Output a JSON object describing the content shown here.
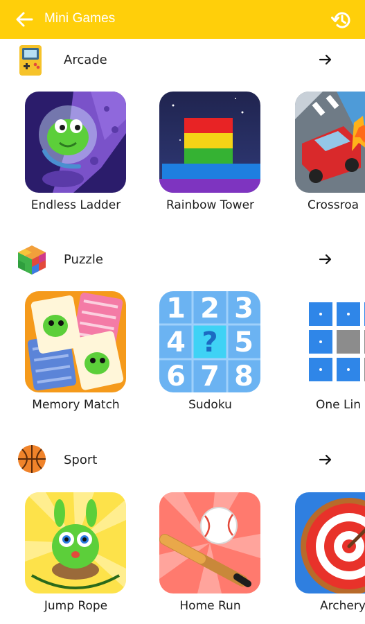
{
  "header": {
    "title": "Mini Games",
    "back_icon": "arrow-left-icon",
    "history_icon": "history-icon",
    "bg_color": "#ffcf0a"
  },
  "sections": [
    {
      "title": "Arcade",
      "icon": "gameboy-icon",
      "games": [
        {
          "label": "Endless Ladder"
        },
        {
          "label": "Rainbow Tower"
        },
        {
          "label": "Crossroa"
        }
      ]
    },
    {
      "title": "Puzzle",
      "icon": "cube-icon",
      "games": [
        {
          "label": "Memory Match"
        },
        {
          "label": "Sudoku"
        },
        {
          "label": "One Lin"
        }
      ]
    },
    {
      "title": "Sport",
      "icon": "basketball-icon",
      "games": [
        {
          "label": "Jump Rope"
        },
        {
          "label": "Home Run"
        },
        {
          "label": "Archery"
        }
      ]
    }
  ],
  "sudoku_digits": [
    "1",
    "2",
    "3",
    "4",
    "?",
    "5",
    "6",
    "7",
    "8"
  ]
}
